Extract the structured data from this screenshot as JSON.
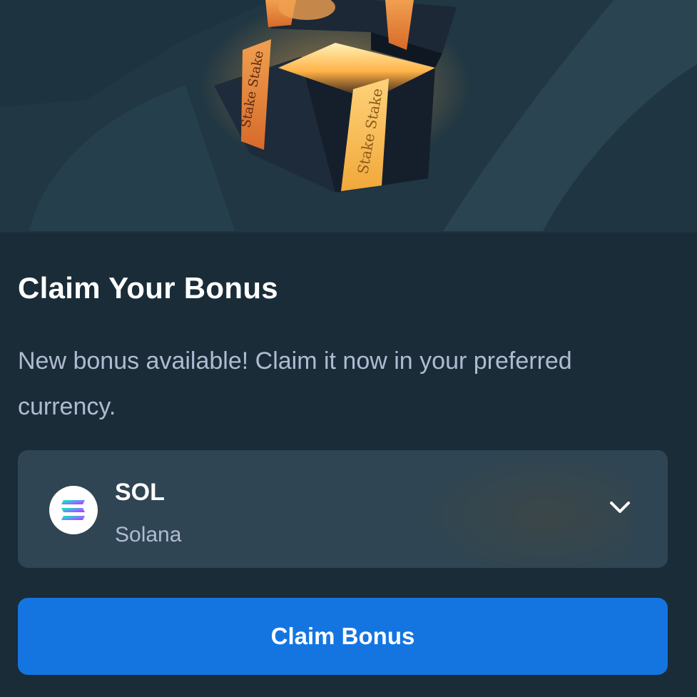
{
  "modal": {
    "title": "Claim Your Bonus",
    "description": "New bonus available! Claim it now in your preferred currency.",
    "hero_icon": "gift-box-icon",
    "hero_ribbon_text": "Stake"
  },
  "currency_select": {
    "code": "SOL",
    "name": "Solana",
    "icon": "solana-icon",
    "dropdown_icon": "chevron-down-icon"
  },
  "claim_button": {
    "label": "Claim Bonus"
  },
  "colors": {
    "background": "#1a2c38",
    "hero_background": "#213743",
    "select_background": "#2f4553",
    "primary_button": "#1475e1",
    "title_text": "#ffffff",
    "muted_text": "#b1bad3"
  }
}
